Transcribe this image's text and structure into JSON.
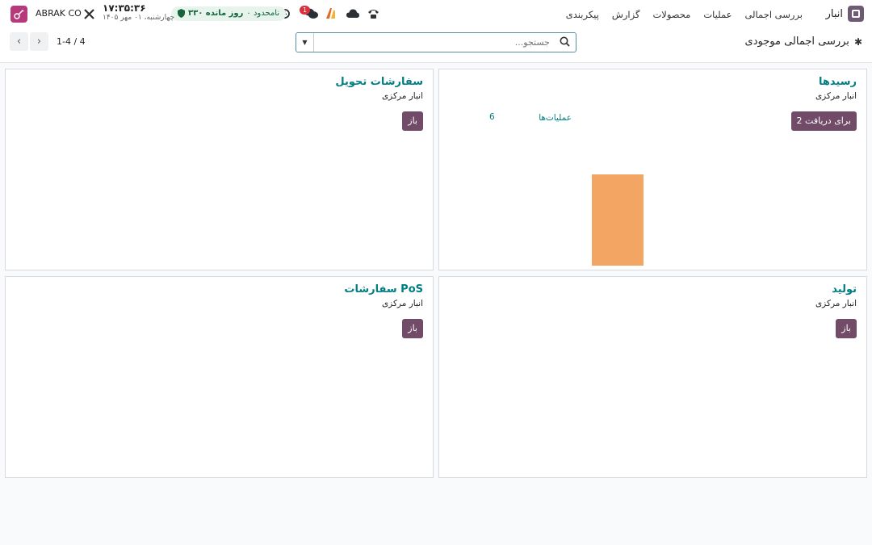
{
  "navbar": {
    "app_name": "انبار",
    "menu": [
      "بررسی اجمالی",
      "عملیات",
      "محصولات",
      "گزارش",
      "پیکربندی"
    ],
    "subscription": {
      "days": "۳۳۰ روز مانده",
      "status": "۰ نامحدود"
    },
    "message_badge": "1",
    "clock": {
      "time": "۱۷:۳۵:۳۶",
      "date": "چهارشنبه، ۰۱ مهر ۱۴۰۵"
    },
    "company": "ABRAK CO"
  },
  "control": {
    "page_title": "بررسی اجمالی موجودی",
    "search_placeholder": "جستجو...",
    "pager": "1-4 / 4"
  },
  "cards": {
    "receipts": {
      "title": "رسیدها",
      "warehouse": "انبار مرکزی",
      "button": "2 برای دریافت",
      "ops_label": "عملیات‌ها",
      "ops_count": "6"
    },
    "delivery": {
      "title": "سفارشات تحویل",
      "warehouse": "انبار مرکزی",
      "button": "باز"
    },
    "manufacturing": {
      "title": "تولید",
      "warehouse": "انبار مرکزی",
      "button": "باز"
    },
    "pos": {
      "title": "سفارشات PoS",
      "warehouse": "انبار مرکزی",
      "button": "باز"
    }
  },
  "colors": {
    "accent": "#017e84",
    "primary_button": "#714b67",
    "graph_bar": "#f3a664"
  }
}
